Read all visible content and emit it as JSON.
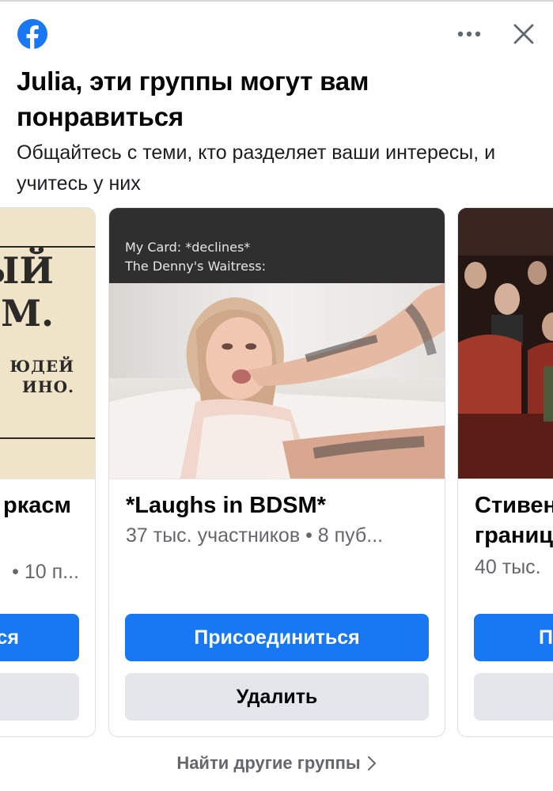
{
  "header": {
    "title": "Julia, эти группы могут вам понравиться",
    "subtitle": "Общайтесь с теми, кто разделяет ваши интересы, и учитесь у них"
  },
  "icons": {
    "logo": "facebook-logo",
    "more": "more-horizontal-icon",
    "close": "close-icon",
    "chevron": "chevron-right-icon"
  },
  "colors": {
    "brand": "#1877f2",
    "secondary_button": "#e4e6eb",
    "muted_text": "#65676b"
  },
  "cards": [
    {
      "name": "ркасм",
      "meta": "• 10 п...",
      "image_text": [
        "ЫЙ",
        "М.",
        "ЮДЕЙ",
        "ИНО."
      ],
      "join_label": "ся",
      "remove_label": ""
    },
    {
      "name": "*Laughs in BDSM*",
      "meta": "37 тыс. участников • 8 пуб...",
      "image_caption": [
        "My Card: *declines*",
        "The Denny's Waitress:"
      ],
      "join_label": "Присоединиться",
      "remove_label": "Удалить"
    },
    {
      "name": "Стивен границ",
      "meta": "40 тыс.",
      "join_label": "Пр",
      "remove_label": ""
    }
  ],
  "footer": {
    "find_more": "Найти другие группы"
  }
}
